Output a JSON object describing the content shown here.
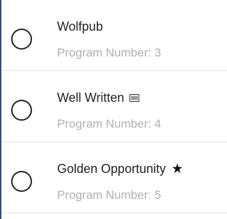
{
  "programs": [
    {
      "name": "Wolfpub",
      "number_text": "Program Number: 3",
      "icon": "",
      "selected": false
    },
    {
      "name": "Well Written",
      "number_text": "Program Number: 4",
      "icon": "tag-icon",
      "selected": false
    },
    {
      "name": "Golden Opportunity",
      "number_text": "Program Number: 5",
      "icon": "star-icon",
      "selected": false
    }
  ],
  "icons": {
    "star_glyph": "★"
  },
  "colors": {
    "accent_border": "#2c4f7a",
    "title_text": "#222222",
    "subtitle_text": "#b0b0b0",
    "divider": "#e4e4e4"
  }
}
